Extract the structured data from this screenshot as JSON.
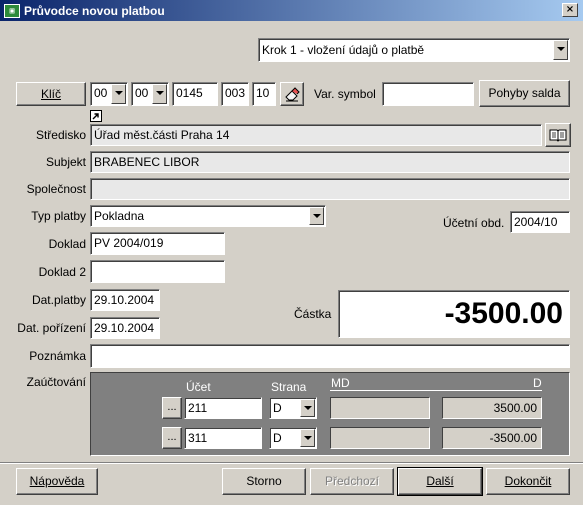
{
  "window": {
    "title": "Průvodce novou platbou",
    "icon": "app-icon",
    "close_glyph": "×"
  },
  "step_combo": {
    "value": "Krok 1 - vložení údajů o platbě"
  },
  "key_button": {
    "label": "Klíč"
  },
  "key_fields": {
    "part1": "00",
    "part2": "00",
    "part3": "0145",
    "part4": "003",
    "part5": "10"
  },
  "var_symbol": {
    "label": "Var. symbol",
    "value": ""
  },
  "balance_button": {
    "label": "Pohyby salda"
  },
  "stredisko": {
    "label": "Středisko",
    "value": "Úřad měst.části Praha 14"
  },
  "subjekt": {
    "label": "Subjekt",
    "value": "BRABENEC LIBOR"
  },
  "spolecnost": {
    "label": "Společnost",
    "value": ""
  },
  "typ_platby": {
    "label": "Typ platby",
    "value": "Pokladna"
  },
  "ucetni_obd": {
    "label": "Účetní obd.",
    "value": "2004/10"
  },
  "doklad": {
    "label": "Doklad",
    "value": "PV 2004/019"
  },
  "doklad2": {
    "label": "Doklad 2",
    "value": ""
  },
  "dat_platby": {
    "label": "Dat.platby",
    "value": "29.10.2004"
  },
  "dat_porizeni": {
    "label": "Dat. pořízení",
    "value": "29.10.2004"
  },
  "castka": {
    "label": "Částka",
    "value": "-3500.00"
  },
  "poznamka": {
    "label": "Poznámka",
    "value": ""
  },
  "zauctovani": {
    "label": "Zaúčtování",
    "headers": {
      "ucet": "Účet",
      "strana": "Strana",
      "md": "MD",
      "d": "D"
    },
    "ellipsis": "...",
    "rows": [
      {
        "ucet": "211",
        "strana": "D",
        "md": "",
        "d": "3500.00"
      },
      {
        "ucet": "311",
        "strana": "D",
        "md": "",
        "d": "-3500.00"
      }
    ]
  },
  "footer": {
    "help": "Nápověda",
    "cancel": "Storno",
    "prev": "Předchozí",
    "next": "Další",
    "finish": "Dokončit"
  }
}
